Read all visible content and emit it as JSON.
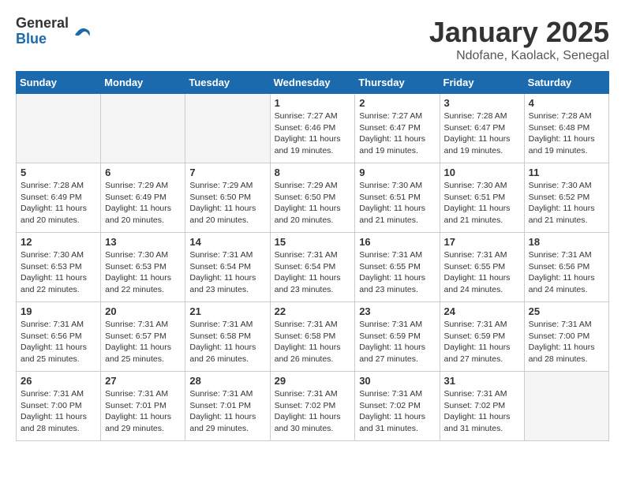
{
  "header": {
    "logo_general": "General",
    "logo_blue": "Blue",
    "title": "January 2025",
    "location": "Ndofane, Kaolack, Senegal"
  },
  "days_of_week": [
    "Sunday",
    "Monday",
    "Tuesday",
    "Wednesday",
    "Thursday",
    "Friday",
    "Saturday"
  ],
  "weeks": [
    [
      {
        "day": "",
        "info": ""
      },
      {
        "day": "",
        "info": ""
      },
      {
        "day": "",
        "info": ""
      },
      {
        "day": "1",
        "sunrise": "7:27 AM",
        "sunset": "6:46 PM",
        "daylight": "11 hours and 19 minutes."
      },
      {
        "day": "2",
        "sunrise": "7:27 AM",
        "sunset": "6:47 PM",
        "daylight": "11 hours and 19 minutes."
      },
      {
        "day": "3",
        "sunrise": "7:28 AM",
        "sunset": "6:47 PM",
        "daylight": "11 hours and 19 minutes."
      },
      {
        "day": "4",
        "sunrise": "7:28 AM",
        "sunset": "6:48 PM",
        "daylight": "11 hours and 19 minutes."
      }
    ],
    [
      {
        "day": "5",
        "sunrise": "7:28 AM",
        "sunset": "6:49 PM",
        "daylight": "11 hours and 20 minutes."
      },
      {
        "day": "6",
        "sunrise": "7:29 AM",
        "sunset": "6:49 PM",
        "daylight": "11 hours and 20 minutes."
      },
      {
        "day": "7",
        "sunrise": "7:29 AM",
        "sunset": "6:50 PM",
        "daylight": "11 hours and 20 minutes."
      },
      {
        "day": "8",
        "sunrise": "7:29 AM",
        "sunset": "6:50 PM",
        "daylight": "11 hours and 20 minutes."
      },
      {
        "day": "9",
        "sunrise": "7:30 AM",
        "sunset": "6:51 PM",
        "daylight": "11 hours and 21 minutes."
      },
      {
        "day": "10",
        "sunrise": "7:30 AM",
        "sunset": "6:51 PM",
        "daylight": "11 hours and 21 minutes."
      },
      {
        "day": "11",
        "sunrise": "7:30 AM",
        "sunset": "6:52 PM",
        "daylight": "11 hours and 21 minutes."
      }
    ],
    [
      {
        "day": "12",
        "sunrise": "7:30 AM",
        "sunset": "6:53 PM",
        "daylight": "11 hours and 22 minutes."
      },
      {
        "day": "13",
        "sunrise": "7:30 AM",
        "sunset": "6:53 PM",
        "daylight": "11 hours and 22 minutes."
      },
      {
        "day": "14",
        "sunrise": "7:31 AM",
        "sunset": "6:54 PM",
        "daylight": "11 hours and 23 minutes."
      },
      {
        "day": "15",
        "sunrise": "7:31 AM",
        "sunset": "6:54 PM",
        "daylight": "11 hours and 23 minutes."
      },
      {
        "day": "16",
        "sunrise": "7:31 AM",
        "sunset": "6:55 PM",
        "daylight": "11 hours and 23 minutes."
      },
      {
        "day": "17",
        "sunrise": "7:31 AM",
        "sunset": "6:55 PM",
        "daylight": "11 hours and 24 minutes."
      },
      {
        "day": "18",
        "sunrise": "7:31 AM",
        "sunset": "6:56 PM",
        "daylight": "11 hours and 24 minutes."
      }
    ],
    [
      {
        "day": "19",
        "sunrise": "7:31 AM",
        "sunset": "6:56 PM",
        "daylight": "11 hours and 25 minutes."
      },
      {
        "day": "20",
        "sunrise": "7:31 AM",
        "sunset": "6:57 PM",
        "daylight": "11 hours and 25 minutes."
      },
      {
        "day": "21",
        "sunrise": "7:31 AM",
        "sunset": "6:58 PM",
        "daylight": "11 hours and 26 minutes."
      },
      {
        "day": "22",
        "sunrise": "7:31 AM",
        "sunset": "6:58 PM",
        "daylight": "11 hours and 26 minutes."
      },
      {
        "day": "23",
        "sunrise": "7:31 AM",
        "sunset": "6:59 PM",
        "daylight": "11 hours and 27 minutes."
      },
      {
        "day": "24",
        "sunrise": "7:31 AM",
        "sunset": "6:59 PM",
        "daylight": "11 hours and 27 minutes."
      },
      {
        "day": "25",
        "sunrise": "7:31 AM",
        "sunset": "7:00 PM",
        "daylight": "11 hours and 28 minutes."
      }
    ],
    [
      {
        "day": "26",
        "sunrise": "7:31 AM",
        "sunset": "7:00 PM",
        "daylight": "11 hours and 28 minutes."
      },
      {
        "day": "27",
        "sunrise": "7:31 AM",
        "sunset": "7:01 PM",
        "daylight": "11 hours and 29 minutes."
      },
      {
        "day": "28",
        "sunrise": "7:31 AM",
        "sunset": "7:01 PM",
        "daylight": "11 hours and 29 minutes."
      },
      {
        "day": "29",
        "sunrise": "7:31 AM",
        "sunset": "7:02 PM",
        "daylight": "11 hours and 30 minutes."
      },
      {
        "day": "30",
        "sunrise": "7:31 AM",
        "sunset": "7:02 PM",
        "daylight": "11 hours and 31 minutes."
      },
      {
        "day": "31",
        "sunrise": "7:31 AM",
        "sunset": "7:02 PM",
        "daylight": "11 hours and 31 minutes."
      },
      {
        "day": "",
        "info": ""
      }
    ]
  ],
  "labels": {
    "sunrise": "Sunrise:",
    "sunset": "Sunset:",
    "daylight": "Daylight:"
  }
}
